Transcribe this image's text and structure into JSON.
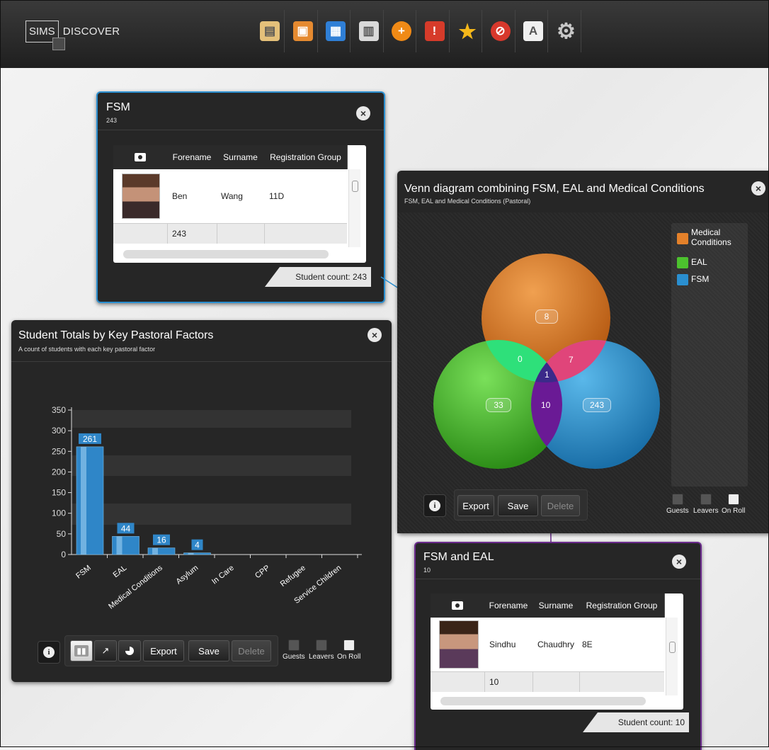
{
  "app": {
    "logo_box": "SIMS",
    "logo_name": "DISCOVER"
  },
  "toolbar": {
    "icons": [
      {
        "name": "student-contacts-icon",
        "color": "#e4c07a",
        "glyph": "▤"
      },
      {
        "name": "staff-contacts-icon",
        "color": "#e58a30",
        "glyph": "▣"
      },
      {
        "name": "groups-icon",
        "color": "#2f7fd6",
        "glyph": "▦"
      },
      {
        "name": "calendar-icon",
        "color": "#d9d9d9",
        "glyph": "▥"
      },
      {
        "name": "add-icon",
        "color": "#f08a16",
        "glyph": "+"
      },
      {
        "name": "alert-icon",
        "color": "#d63b2a",
        "glyph": "!"
      },
      {
        "name": "star-icon",
        "color": "#f5b81a",
        "glyph": "★"
      },
      {
        "name": "exclusion-icon",
        "color": "#d8382c",
        "glyph": "⊘"
      },
      {
        "name": "document-icon",
        "color": "#f0f0f0",
        "glyph": "A"
      },
      {
        "name": "settings-icon",
        "color": "#c8c8c8",
        "glyph": "⚙"
      }
    ]
  },
  "fsm_panel": {
    "title": "FSM",
    "subtitle": "243",
    "columns": [
      "Forename",
      "Surname",
      "Registration Group"
    ],
    "row": {
      "forename": "Ben",
      "surname": "Wang",
      "group": "11D"
    },
    "footer_count": "243",
    "student_count": "Student count: 243"
  },
  "venn_panel": {
    "title": "Venn diagram combining FSM, EAL and Medical Conditions",
    "subtitle": "FSM, EAL and Medical Conditions (Pastoral)",
    "regions": {
      "medical": "8",
      "eal": "33",
      "fsm": "243",
      "eal_medical": "0",
      "medical_fsm": "7",
      "eal_fsm": "10",
      "all": "1"
    },
    "legend": [
      {
        "label": "Medical Conditions",
        "color": "#e4812a"
      },
      {
        "label": "EAL",
        "color": "#4cc22e"
      },
      {
        "label": "FSM",
        "color": "#2a8fd0"
      }
    ],
    "buttons": {
      "export": "Export",
      "save": "Save",
      "delete": "Delete"
    },
    "checks": {
      "guests": "Guests",
      "leavers": "Leavers",
      "on_roll": "On Roll"
    }
  },
  "totals_panel": {
    "title": "Student Totals by Key Pastoral Factors",
    "subtitle": "A count of students with each key pastoral factor",
    "buttons": {
      "export": "Export",
      "save": "Save",
      "delete": "Delete"
    },
    "checks": {
      "guests": "Guests",
      "leavers": "Leavers",
      "on_roll": "On Roll"
    }
  },
  "chart_data": {
    "type": "bar",
    "categories": [
      "FSM",
      "EAL",
      "Medical Conditions",
      "Asylum",
      "In Care",
      "CPP",
      "Refugee",
      "Service Children"
    ],
    "values": [
      261,
      44,
      16,
      4,
      0,
      0,
      0,
      0
    ],
    "data_labels": [
      "261",
      "44",
      "16",
      "4",
      "",
      "",
      "",
      ""
    ],
    "ylim": [
      0,
      350
    ],
    "yticks": [
      0,
      50,
      100,
      150,
      200,
      250,
      300,
      350
    ],
    "bar_color": "#2f86c8"
  },
  "fsm_eal_panel": {
    "title": "FSM and EAL",
    "subtitle": "10",
    "columns": [
      "Forename",
      "Surname",
      "Registration Group"
    ],
    "row": {
      "forename": "Sindhu",
      "surname": "Chaudhry",
      "group": "8E"
    },
    "footer_count": "10",
    "student_count": "Student count: 10"
  }
}
